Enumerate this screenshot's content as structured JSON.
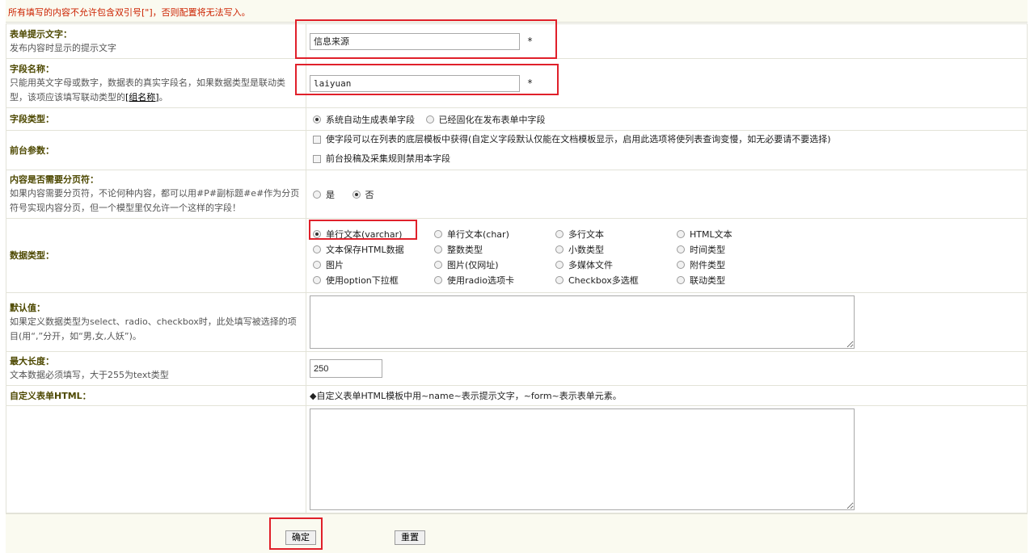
{
  "notice": "所有填写的内容不允许包含双引号[\"]，否则配置将无法写入。",
  "fields": {
    "prompt_text": {
      "title": "表单提示文字：",
      "desc": "发布内容时显示的提示文字",
      "value": "信息来源",
      "required_mark": "*"
    },
    "field_name": {
      "title": "字段名称：",
      "desc": "只能用英文字母或数字，数据表的真实字段名，如果数据类型是联动类型，该项应该填写联动类型的",
      "desc_link": "[组名称]",
      "desc_end": "。",
      "value": "laiyuan",
      "required_mark": "*"
    },
    "field_type": {
      "title": "字段类型：",
      "options": [
        "系统自动生成表单字段",
        "已经固化在发布表单中字段"
      ],
      "selected": 0
    },
    "frontend_params": {
      "title": "前台参数：",
      "options": [
        "使字段可以在列表的底层模板中获得(自定义字段默认仅能在文档模板显示，启用此选项将使列表查询变慢，如无必要请不要选择)",
        "前台投稿及采集规则禁用本字段"
      ]
    },
    "pagination": {
      "title": "内容是否需要分页符：",
      "desc": "如果内容需要分页符，不论何种内容，都可以用#P#副标题#e#作为分页符号实现内容分页，但一个模型里仅允许一个这样的字段！",
      "options": [
        "是",
        "否"
      ],
      "selected": 1
    },
    "data_type": {
      "title": "数据类型：",
      "options": [
        "单行文本(varchar)",
        "单行文本(char)",
        "多行文本",
        "HTML文本",
        "文本保存HTML数据",
        "整数类型",
        "小数类型",
        "时间类型",
        "图片",
        "图片(仅网址)",
        "多媒体文件",
        "附件类型",
        "使用option下拉框",
        "使用radio选项卡",
        "Checkbox多选框",
        "联动类型"
      ],
      "selected": 0
    },
    "default_value": {
      "title": "默认值：",
      "desc": "如果定义数据类型为select、radio、checkbox时，此处填写被选择的项目(用“,”分开，如“男,女,人妖”)。",
      "value": ""
    },
    "max_length": {
      "title": "最大长度：",
      "desc": "文本数据必须填写，大于255为text类型",
      "value": "250"
    },
    "custom_html": {
      "title": "自定义表单HTML：",
      "hint": "◆自定义表单HTML模板中用~name~表示提示文字，~form~表示表单元素。",
      "value": ""
    }
  },
  "buttons": {
    "confirm": "确定",
    "reset": "重置"
  },
  "colors": {
    "label": "#4d4800",
    "notice": "#cc2200",
    "highlight": "#e0202a"
  }
}
